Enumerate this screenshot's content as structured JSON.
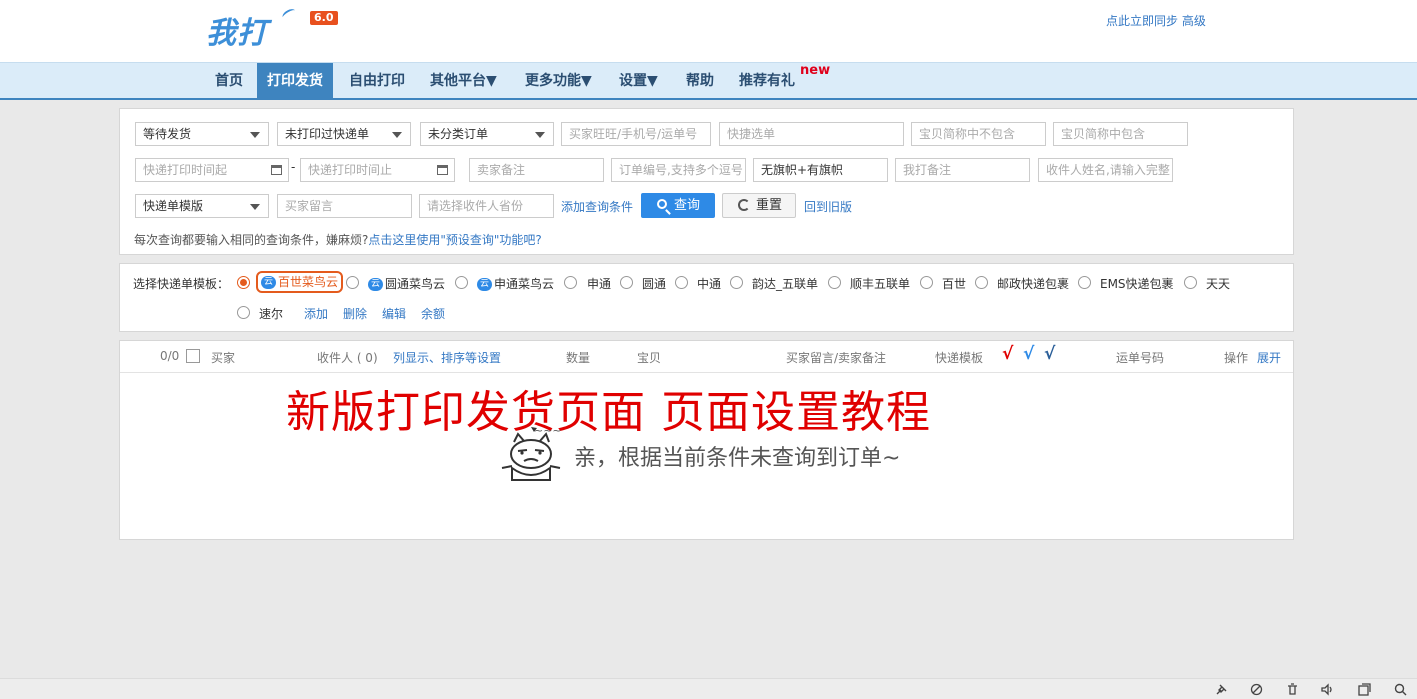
{
  "header": {
    "logo_text": "我打",
    "version": "6.0",
    "sync_link": "点此立即同步 高级"
  },
  "nav": {
    "items": [
      "首页",
      "打印发货",
      "自由打印",
      "其他平台▼",
      "更多功能▼",
      "设置▼",
      "帮助",
      "推荐有礼"
    ],
    "active_index": 1,
    "new_badge": "new"
  },
  "filters": {
    "status_select": "等待发货",
    "print_select": "未打印过快递单",
    "category_select": "未分类订单",
    "buyer_input_placeholder": "买家旺旺/手机号/运单号",
    "quick_select_placeholder": "快捷选单",
    "exclude_short_placeholder": "宝贝简称中不包含",
    "include_short_placeholder": "宝贝简称中包含",
    "time_start_placeholder": "快递打印时间起",
    "time_sep": "-",
    "time_end_placeholder": "快递打印时间止",
    "seller_note_placeholder": "卖家备注",
    "order_no_placeholder": "订单编号,支持多个逗号",
    "flag_select": "无旗帜+有旗帜",
    "my_note_placeholder": "我打备注",
    "receiver_placeholder": "收件人姓名,请输入完整",
    "template_select": "快递单模版",
    "buyer_msg_placeholder": "买家留言",
    "province_placeholder": "请选择收件人省份",
    "add_condition": "添加查询条件",
    "query_button": "查询",
    "reset_button": "重置",
    "old_version_link": "回到旧版",
    "hint_text": "每次查询都要输入相同的查询条件，嫌麻烦?",
    "hint_link": "点击这里使用\"预设查询\"功能吧?"
  },
  "templates": {
    "label": "选择快递单模板：",
    "options": [
      "百世菜鸟云",
      "圆通菜鸟云",
      "申通菜鸟云",
      "申通",
      "圆通",
      "中通",
      "韵达_五联单",
      "顺丰五联单",
      "百世",
      "邮政快递包裹",
      "EMS快递包裹",
      "天天",
      "速尔"
    ],
    "cloud_badge": "云",
    "selected_index": 0,
    "actions": [
      "添加",
      "删除",
      "编辑",
      "余额"
    ]
  },
  "table": {
    "count": "0/0",
    "headers": [
      "买家",
      "收件人 ( 0)",
      "列显示、排序等设置",
      "数量",
      "宝贝",
      "买家留言/卖家备注",
      "快递模板",
      "运单号码",
      "操作",
      "展开"
    ],
    "check_marks": [
      "√",
      "√",
      "√"
    ],
    "check_colors": [
      "#e00000",
      "#2e8ae6",
      "#2b5f99"
    ]
  },
  "overlay": {
    "banner": "新版打印发货页面  页面设置教程",
    "empty_message": "亲，根据当前条件未查询到订单~",
    "mascot_tilde": "~~~"
  },
  "colors": {
    "accent": "#3e84bf",
    "nav_bg": "#dbecf9",
    "primary_button": "#2e8ae6",
    "selected_template": "#e45b1d",
    "banner_red": "#e00000"
  },
  "statusbar_icons": [
    "pin-icon",
    "no-audio-icon",
    "trash-icon",
    "volume-icon",
    "window-icon",
    "search-icon"
  ]
}
